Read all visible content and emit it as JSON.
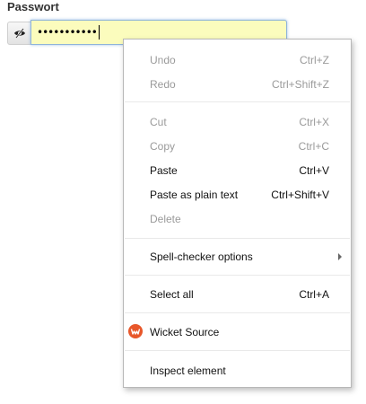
{
  "form": {
    "label": "Passwort",
    "password_masked": "•••••••••••",
    "toggle_icon": "eye-slash-icon"
  },
  "menu": {
    "undo": {
      "label": "Undo",
      "shortcut": "Ctrl+Z"
    },
    "redo": {
      "label": "Redo",
      "shortcut": "Ctrl+Shift+Z"
    },
    "cut": {
      "label": "Cut",
      "shortcut": "Ctrl+X"
    },
    "copy": {
      "label": "Copy",
      "shortcut": "Ctrl+C"
    },
    "paste": {
      "label": "Paste",
      "shortcut": "Ctrl+V"
    },
    "paste_plain": {
      "label": "Paste as plain text",
      "shortcut": "Ctrl+Shift+V"
    },
    "delete": {
      "label": "Delete"
    },
    "spell": {
      "label": "Spell-checker options"
    },
    "select_all": {
      "label": "Select all",
      "shortcut": "Ctrl+A"
    },
    "wicket": {
      "label": "Wicket Source",
      "icon": "wicket-source-icon"
    },
    "inspect": {
      "label": "Inspect element"
    }
  },
  "colors": {
    "input_bg": "#fbfcbd",
    "wicket_icon": "#e8572a",
    "disabled_text": "#9a9a9a"
  }
}
